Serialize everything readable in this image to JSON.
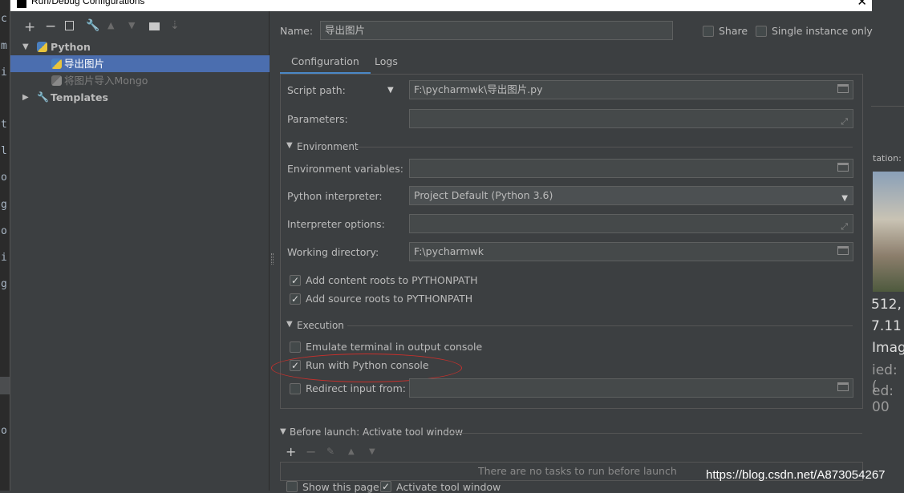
{
  "window": {
    "title": "Run/Debug Configurations"
  },
  "toolbar": [
    "add-icon",
    "remove-icon",
    "copy-icon",
    "wrench-icon",
    "move-up-icon",
    "move-down-icon",
    "folder-add-icon",
    "sort-icon"
  ],
  "tree": {
    "python_group": "Python",
    "items": [
      "导出图片",
      "将图片导入Mongo"
    ],
    "templates": "Templates"
  },
  "config": {
    "name_label": "Name:",
    "name_value": "导出图片",
    "share_label": "Share",
    "single_instance_label": "Single instance only",
    "tabs": [
      "Configuration",
      "Logs"
    ],
    "script_path_label": "Script path:",
    "script_path_value": "F:\\pycharmwk\\导出图片.py",
    "parameters_label": "Parameters:",
    "environment_section": "Environment",
    "env_vars_label": "Environment variables:",
    "interpreter_label": "Python interpreter:",
    "interpreter_value": "Project Default (Python 3.6)",
    "interp_options_label": "Interpreter options:",
    "workdir_label": "Working directory:",
    "workdir_value": "F:\\pycharmwk",
    "add_content_roots": "Add content roots to PYTHONPATH",
    "add_source_roots": "Add source roots to PYTHONPATH",
    "execution_section": "Execution",
    "emulate_terminal": "Emulate terminal in output console",
    "run_with_console": "Run with Python console",
    "redirect_input": "Redirect input from:",
    "before_launch": "Before launch: Activate tool window",
    "no_tasks": "There are no tasks to run before launch",
    "show_page": "Show this page",
    "activate_tool_window": "Activate tool window"
  },
  "background": {
    "left_chars": [
      "c",
      "m",
      "i",
      "",
      "t",
      "l",
      "o",
      "o",
      "g",
      "o",
      "i",
      "g"
    ],
    "right_texts": [
      "tation:",
      "512,",
      "7.11",
      "Imag",
      "ied: (",
      "ed: 00"
    ],
    "watermark": "https://blog.csdn.net/A873054267"
  }
}
